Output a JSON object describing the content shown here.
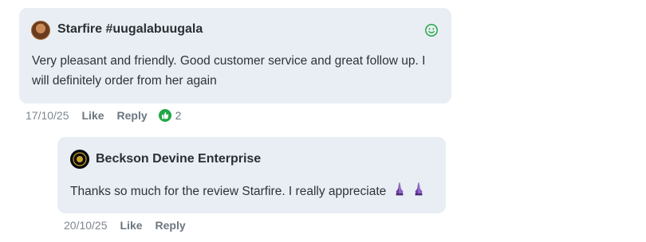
{
  "comments": [
    {
      "author": "Starfire #uugalabuugala",
      "text": "Very pleasant and friendly. Good customer service and great follow up. I will definitely order from her again",
      "date": "17/10/25",
      "like_label": "Like",
      "reply_label": "Reply",
      "like_count": "2",
      "reaction_icon": "thumbs-up-icon",
      "reaction_color": "#22a747",
      "emoji_button_icon": "smiley-icon"
    },
    {
      "author": "Beckson Devine Enterprise",
      "text": "Thanks so much for the review Starfire. I really appreciate",
      "emoji_icons": [
        "praying-hands-icon",
        "praying-hands-icon"
      ],
      "date": "20/10/25",
      "like_label": "Like",
      "reply_label": "Reply"
    }
  ],
  "colors": {
    "bubble": "#e8eef4",
    "accent_green": "#22a747"
  }
}
